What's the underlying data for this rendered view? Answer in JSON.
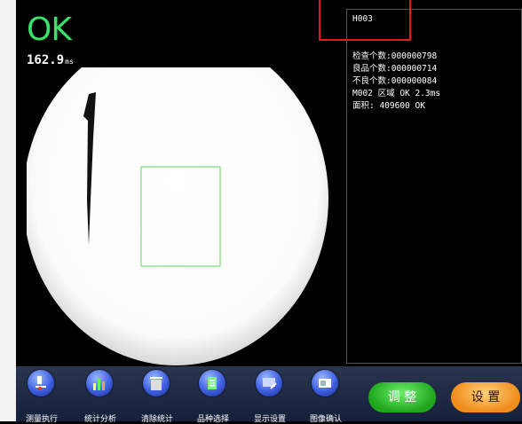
{
  "status": {
    "result": "OK",
    "time_value": "162.9",
    "time_unit": "ms"
  },
  "info_panel": {
    "program": "H003",
    "lines": [
      "检查个数:000000798",
      "良品个数:000000714",
      "不良个数:000000084",
      "M002 区域 OK  2.3ms",
      " 面积:  409600 OK"
    ]
  },
  "toolbar": {
    "items": [
      {
        "label": "测量执行",
        "icon": "microscope-icon"
      },
      {
        "label": "统计分析",
        "icon": "chart-icon"
      },
      {
        "label": "清除统计",
        "icon": "trash-icon"
      },
      {
        "label": "品种选择",
        "icon": "product-select-icon"
      },
      {
        "label": "显示设置",
        "icon": "display-settings-icon"
      },
      {
        "label": "图像确认",
        "icon": "image-confirm-icon"
      }
    ],
    "adjust_label": "调 整",
    "setting_label": "设 置"
  },
  "colors": {
    "ok_green": "#39e26b",
    "roi_green": "#5fd55f",
    "highlight_red": "#e21b1b"
  }
}
